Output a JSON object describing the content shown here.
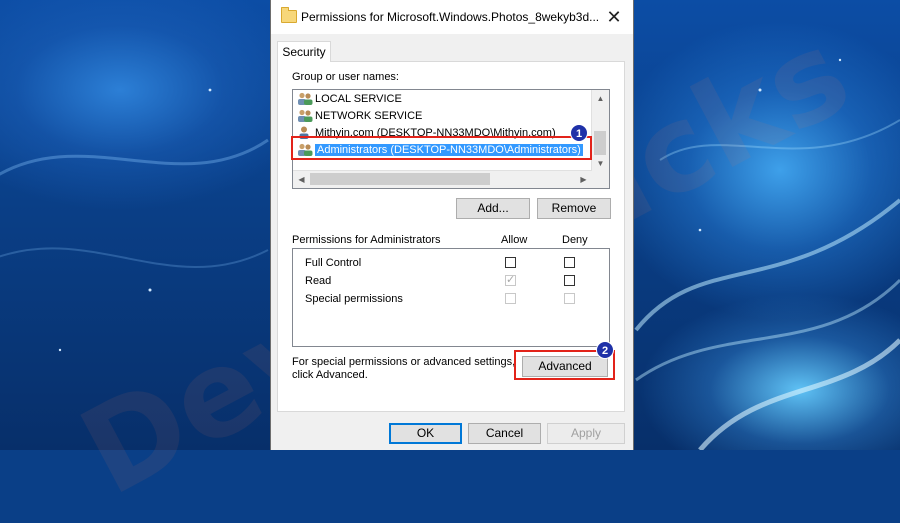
{
  "window": {
    "title": "Permissions for Microsoft.Windows.Photos_8wekyb3d...",
    "close_glyph": "✕"
  },
  "tabs": [
    {
      "label": "Security",
      "active": true
    }
  ],
  "group_section": {
    "label": "Group or user names:",
    "items": [
      {
        "name": "LOCAL SERVICE",
        "icon": "users-group-icon",
        "selected": false
      },
      {
        "name": "NETWORK SERVICE",
        "icon": "users-group-icon",
        "selected": false
      },
      {
        "name": "Mithyin.com (DESKTOP-NN33MDO\\Mithyin.com)",
        "icon": "single-user-icon",
        "selected": false
      },
      {
        "name": "Administrators (DESKTOP-NN33MDO\\Administrators)",
        "icon": "users-group-icon",
        "selected": true
      }
    ]
  },
  "buttons": {
    "add": "Add...",
    "remove": "Remove",
    "advanced": "Advanced",
    "ok": "OK",
    "cancel": "Cancel",
    "apply": "Apply"
  },
  "permissions": {
    "label": "Permissions for Administrators",
    "allow_header": "Allow",
    "deny_header": "Deny",
    "rows": [
      {
        "name": "Full Control",
        "allow": false,
        "deny": false,
        "allow_enabled": true,
        "deny_enabled": true
      },
      {
        "name": "Read",
        "allow": true,
        "deny": false,
        "allow_enabled": false,
        "deny_enabled": true
      },
      {
        "name": "Special permissions",
        "allow": false,
        "deny": false,
        "allow_enabled": false,
        "deny_enabled": false
      }
    ]
  },
  "advanced_hint": {
    "line1": "For special permissions or advanced settings,",
    "line2": "click Advanced."
  },
  "annotations": {
    "badge1": "1",
    "badge2": "2",
    "highlight_color": "#e2231a",
    "badge_color": "#1f31a8"
  },
  "watermark": "DeviceTricks",
  "colors": {
    "selection": "#3399ff",
    "default_button_border": "#0078d7"
  }
}
